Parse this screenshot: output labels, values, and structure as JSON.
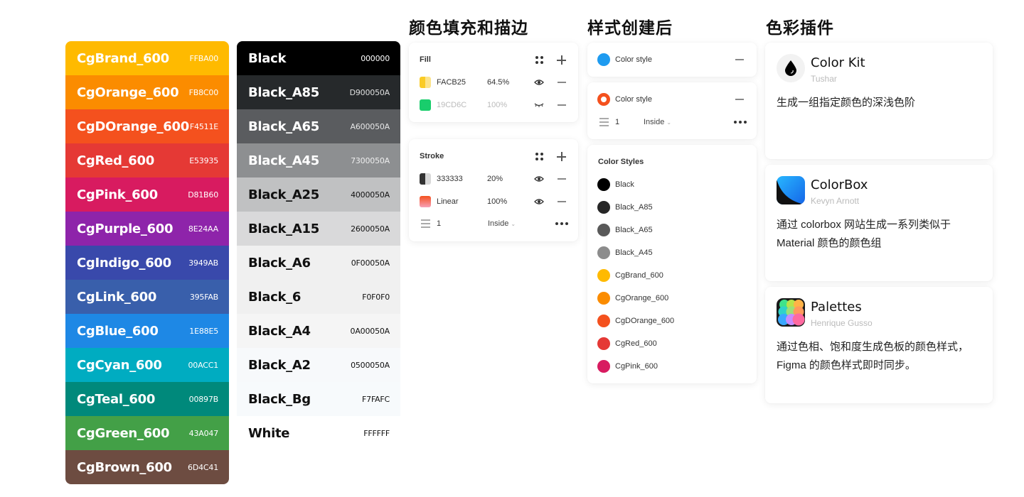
{
  "palettes": {
    "color": [
      {
        "name": "CgBrand_600",
        "hex": "FFBA00",
        "bg": "#FFBA00",
        "fg": "#ffffff"
      },
      {
        "name": "CgOrange_600",
        "hex": "FB8C00",
        "bg": "#FB8C00",
        "fg": "#ffffff"
      },
      {
        "name": "CgDOrange_600",
        "hex": "F4511E",
        "bg": "#F4511E",
        "fg": "#ffffff"
      },
      {
        "name": "CgRed_600",
        "hex": "E53935",
        "bg": "#E53935",
        "fg": "#ffffff"
      },
      {
        "name": "CgPink_600",
        "hex": "D81B60",
        "bg": "#D81B60",
        "fg": "#ffffff"
      },
      {
        "name": "CgPurple_600",
        "hex": "8E24AA",
        "bg": "#8E24AA",
        "fg": "#ffffff"
      },
      {
        "name": "CgIndigo_600",
        "hex": "3949AB",
        "bg": "#3949AB",
        "fg": "#ffffff"
      },
      {
        "name": "CgLink_600",
        "hex": "395FAB",
        "bg": "#395FAB",
        "fg": "#ffffff"
      },
      {
        "name": "CgBlue_600",
        "hex": "1E88E5",
        "bg": "#1E88E5",
        "fg": "#ffffff"
      },
      {
        "name": "CgCyan_600",
        "hex": "00ACC1",
        "bg": "#00ACC1",
        "fg": "#ffffff"
      },
      {
        "name": "CgTeal_600",
        "hex": "00897B",
        "bg": "#00897B",
        "fg": "#ffffff"
      },
      {
        "name": "CgGreen_600",
        "hex": "43A047",
        "bg": "#43A047",
        "fg": "#ffffff"
      },
      {
        "name": "CgBrown_600",
        "hex": "6D4C41",
        "bg": "#6D4C41",
        "fg": "#ffffff"
      }
    ],
    "black": [
      {
        "name": "Black",
        "hex": "000000",
        "bg": "#000000",
        "fg": "#ffffff"
      },
      {
        "name": "Black_A85",
        "hex": "D900050A",
        "bg": "#26292b",
        "fg": "#ffffff"
      },
      {
        "name": "Black_A65",
        "hex": "A600050A",
        "bg": "#5a5c5f",
        "fg": "#ffffff"
      },
      {
        "name": "Black_A45",
        "hex": "7300050A",
        "bg": "#8d8f91",
        "fg": "#ffffff"
      },
      {
        "name": "Black_A25",
        "hex": "4000050A",
        "bg": "#c0c1c2",
        "fg": "#111111"
      },
      {
        "name": "Black_A15",
        "hex": "2600050A",
        "bg": "#d9d9da",
        "fg": "#111111"
      },
      {
        "name": "Black_A6",
        "hex": "0F00050A",
        "bg": "#f0f0f0",
        "fg": "#111111"
      },
      {
        "name": "Black_6",
        "hex": "F0F0F0",
        "bg": "#f0f0f0",
        "fg": "#111111"
      },
      {
        "name": "Black_A4",
        "hex": "0A00050A",
        "bg": "#f5f5f5",
        "fg": "#111111"
      },
      {
        "name": "Black_A2",
        "hex": "0500050A",
        "bg": "#f7f9fb",
        "fg": "#111111"
      },
      {
        "name": "Black_Bg",
        "hex": "F7FAFC",
        "bg": "#F7FAFC",
        "fg": "#111111"
      },
      {
        "name": "White",
        "hex": "FFFFFF",
        "bg": "#FFFFFF",
        "fg": "#111111"
      }
    ]
  },
  "sections": {
    "fill_stroke_title": "颜色填充和描边",
    "style_created_title": "样式创建后",
    "plugins_title": "色彩插件"
  },
  "fill": {
    "header": "Fill",
    "rows": [
      {
        "value": "FACB25",
        "opacity": "64.5%",
        "visible": true,
        "color": "#FACB25"
      },
      {
        "value": "19CD6C",
        "opacity": "100%",
        "visible": false,
        "color": "#19CD6C"
      }
    ]
  },
  "stroke": {
    "header": "Stroke",
    "rows": [
      {
        "value": "333333",
        "opacity": "20%",
        "visible": true,
        "color": "#333333"
      },
      {
        "value": "Linear",
        "opacity": "100%",
        "visible": true,
        "color": "#F4511E"
      }
    ],
    "weight": "1",
    "position": "Inside"
  },
  "style_cards": {
    "fill_style": {
      "label": "Color style",
      "color": "#1E9BF0"
    },
    "stroke_style": {
      "label": "Color style",
      "color": "#F4511E",
      "weight": "1",
      "position": "Inside"
    },
    "color_styles": {
      "header": "Color Styles",
      "items": [
        {
          "name": "Black",
          "color": "#000000"
        },
        {
          "name": "Black_A85",
          "color": "#262626"
        },
        {
          "name": "Black_A65",
          "color": "#595959"
        },
        {
          "name": "Black_A45",
          "color": "#8c8c8c"
        },
        {
          "name": "CgBrand_600",
          "color": "#FFBA00"
        },
        {
          "name": "CgOrange_600",
          "color": "#FB8C00"
        },
        {
          "name": "CgDOrange_600",
          "color": "#F4511E"
        },
        {
          "name": "CgRed_600",
          "color": "#E53935"
        },
        {
          "name": "CgPink_600",
          "color": "#D81B60"
        }
      ]
    }
  },
  "plugins": [
    {
      "name": "Color Kit",
      "author": "Tushar",
      "description": "生成一组指定颜色的深浅色阶",
      "icon": "drop-icon"
    },
    {
      "name": "ColorBox",
      "author": "Kevyn Arnott",
      "description": "通过 colorbox 网站生成一系列类似于 Material 颜色的颜色组",
      "icon": "colorbox-icon"
    },
    {
      "name": "Palettes",
      "author": "Henrique Gusso",
      "description": "通过色相、饱和度生成色板的颜色样式，Figma 的颜色样式即时同步。",
      "icon": "palettes-icon"
    }
  ]
}
